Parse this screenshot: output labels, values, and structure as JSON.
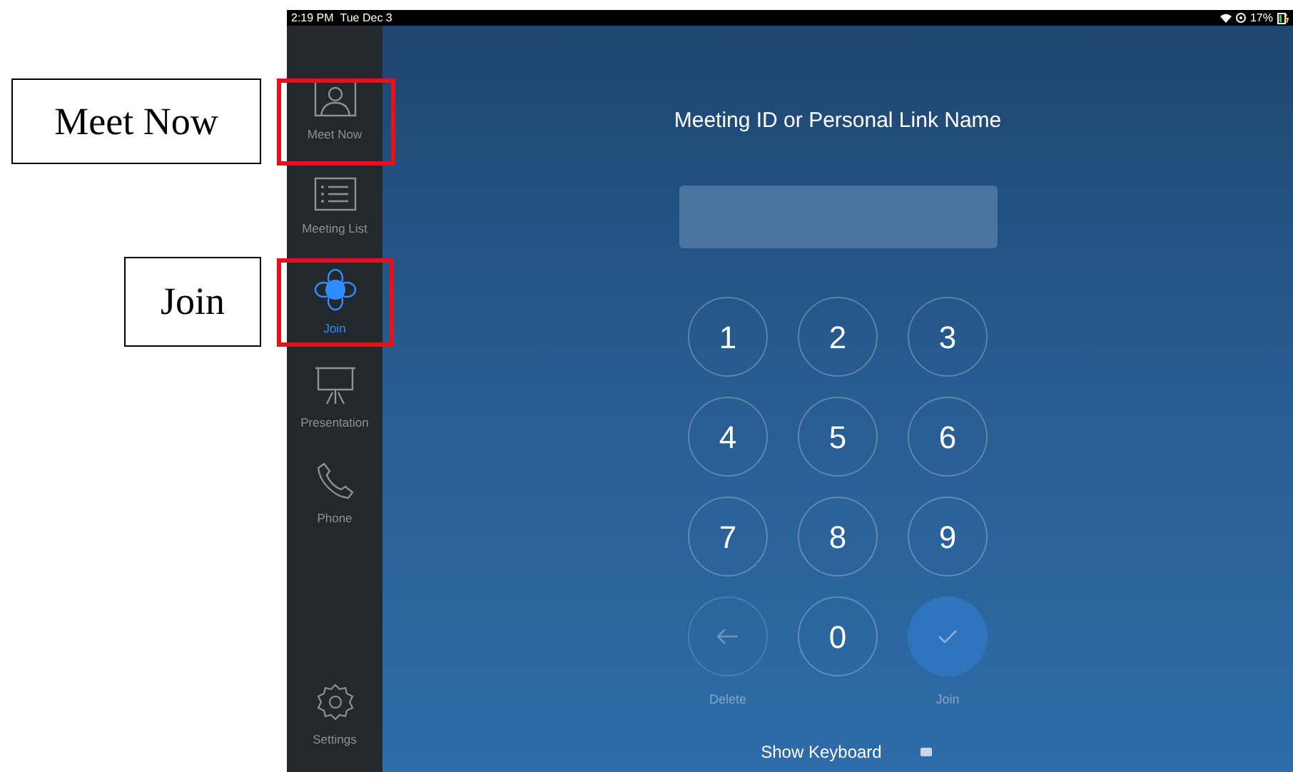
{
  "status_bar": {
    "time": "2:19 PM",
    "date": "Tue Dec 3",
    "battery": "17%"
  },
  "sidebar": {
    "items": [
      {
        "kind": "meet",
        "label": "Meet Now",
        "selected": false
      },
      {
        "kind": "list",
        "label": "Meeting List",
        "selected": false
      },
      {
        "kind": "join",
        "label": "Join",
        "selected": true
      },
      {
        "kind": "presentation",
        "label": "Presentation",
        "selected": false
      },
      {
        "kind": "phone",
        "label": "Phone",
        "selected": false
      }
    ],
    "settings": {
      "label": "Settings"
    }
  },
  "main": {
    "title": "Meeting ID or Personal Link Name",
    "keys": [
      {
        "kind": "digit",
        "label": "1"
      },
      {
        "kind": "digit",
        "label": "2"
      },
      {
        "kind": "digit",
        "label": "3"
      },
      {
        "kind": "digit",
        "label": "4"
      },
      {
        "kind": "digit",
        "label": "5"
      },
      {
        "kind": "digit",
        "label": "6"
      },
      {
        "kind": "digit",
        "label": "7"
      },
      {
        "kind": "digit",
        "label": "8"
      },
      {
        "kind": "digit",
        "label": "9"
      },
      {
        "kind": "delete"
      },
      {
        "kind": "digit",
        "label": "0"
      },
      {
        "kind": "join"
      }
    ],
    "key_captions": [
      "Delete",
      "Join"
    ],
    "show_keyboard": "Show Keyboard"
  },
  "callouts": [
    {
      "kind": "meet",
      "label": "Meet Now"
    },
    {
      "kind": "join",
      "label": "Join"
    }
  ]
}
